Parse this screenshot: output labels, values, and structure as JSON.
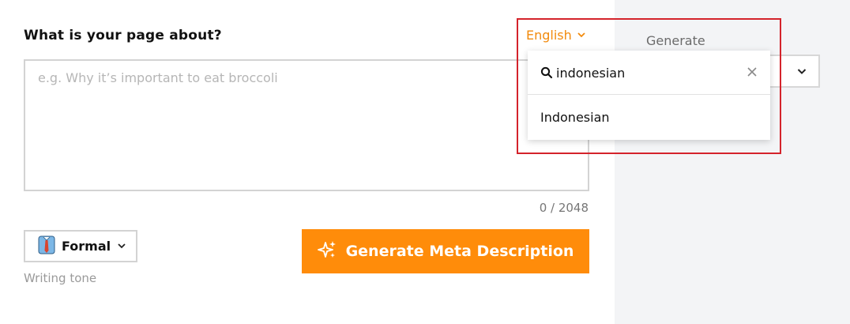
{
  "main": {
    "question": "What is your page about?",
    "textarea_placeholder": "e.g. Why it’s important to eat broccoli",
    "textarea_value": "",
    "counter": "0 / 2048"
  },
  "language": {
    "selected": "English",
    "search_value": "indonesian",
    "options": [
      "Indonesian"
    ]
  },
  "tone": {
    "selected": "Formal",
    "hint": "Writing tone"
  },
  "generate_button": {
    "label": "Generate Meta Description"
  },
  "side_panel": {
    "label": "Generate"
  },
  "colors": {
    "accent": "#ff8c0a",
    "link_orange": "#f28a0c",
    "highlight": "#d4232b",
    "panel_bg": "#f3f4f6"
  }
}
